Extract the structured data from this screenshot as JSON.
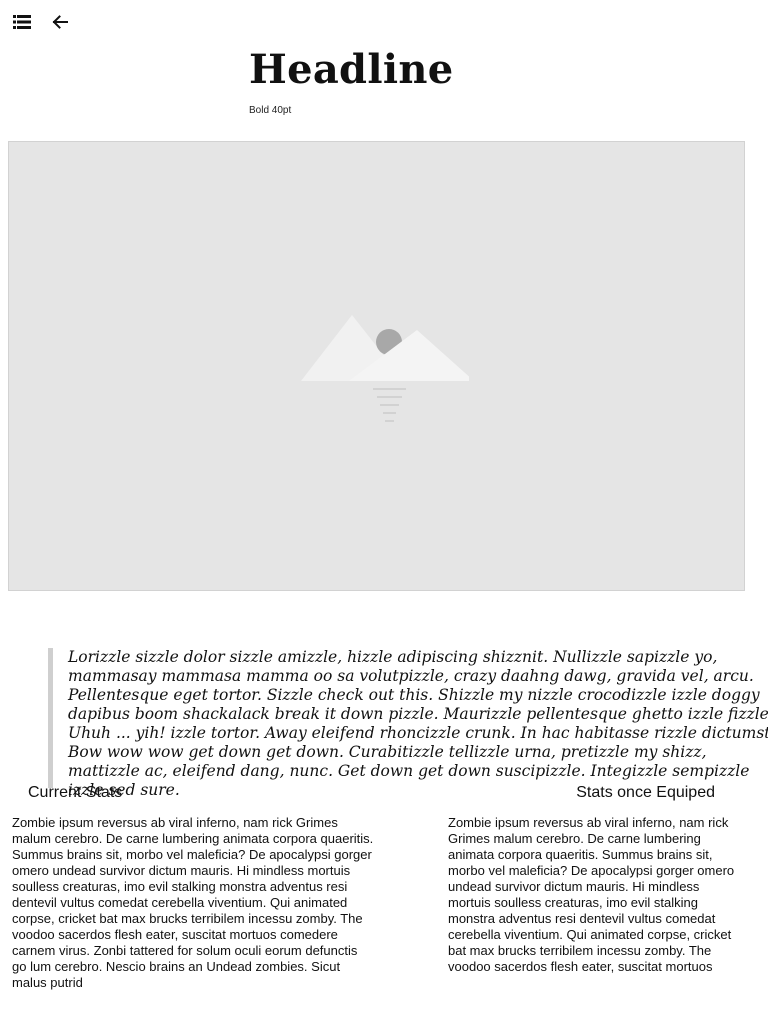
{
  "toolbar": {
    "menu_icon": "list-menu-icon",
    "back_icon": "back-arrow-icon"
  },
  "header": {
    "title": "Headline",
    "subtitle": "Bold 40pt"
  },
  "image": {
    "icon": "image-placeholder-icon",
    "background": "#e5e5e5"
  },
  "quote": {
    "text": "Lorizzle sizzle dolor sizzle amizzle, hizzle adipiscing shizznit. Nullizzle sapizzle yo, mammasay mammasa mamma oo sa volutpizzle, crazy daahng dawg, gravida vel, arcu. Pellentesque eget tortor. Sizzle check out this. Shizzle my nizzle crocodizzle izzle doggy dapibus boom shackalack break it down pizzle. Maurizzle pellentesque ghetto izzle fizzle. Uhuh ... yih! izzle tortor. Away eleifend rhoncizzle crunk. In hac habitasse rizzle dictumst. Bow wow wow get down get down. Curabitizzle tellizzle urna, pretizzle my shizz, mattizzle ac, eleifend dang, nunc. Get down get down suscipizzle. Integizzle sempizzle izzle sed sure."
  },
  "stats": {
    "current": {
      "title": "Current Stats",
      "body": "Zombie ipsum reversus ab viral inferno, nam rick Grimes malum cerebro. De carne lumbering animata corpora quaeritis. Summus brains sit, morbo vel maleficia? De apocalypsi gorger omero undead survivor dictum mauris. Hi mindless mortuis soulless creaturas, imo evil stalking monstra adventus resi dentevil vultus comedat cerebella viventium. Qui animated corpse, cricket bat max brucks terribilem incessu zomby. The voodoo sacerdos flesh eater, suscitat mortuos comedere carnem virus. Zonbi tattered for solum oculi eorum defunctis go lum cerebro. Nescio brains an Undead zombies. Sicut malus putrid"
    },
    "equipped": {
      "title": "Stats once Equiped",
      "body": "Zombie ipsum reversus ab viral inferno, nam rick Grimes malum cerebro. De carne lumbering animata corpora quaeritis. Summus brains sit, morbo vel maleficia? De apocalypsi gorger omero undead survivor dictum mauris. Hi mindless mortuis soulless creaturas, imo evil stalking monstra adventus resi dentevil vultus comedat cerebella viventium. Qui animated corpse, cricket bat max brucks terribilem incessu zomby. The voodoo sacerdos flesh eater, suscitat mortuos"
    }
  }
}
